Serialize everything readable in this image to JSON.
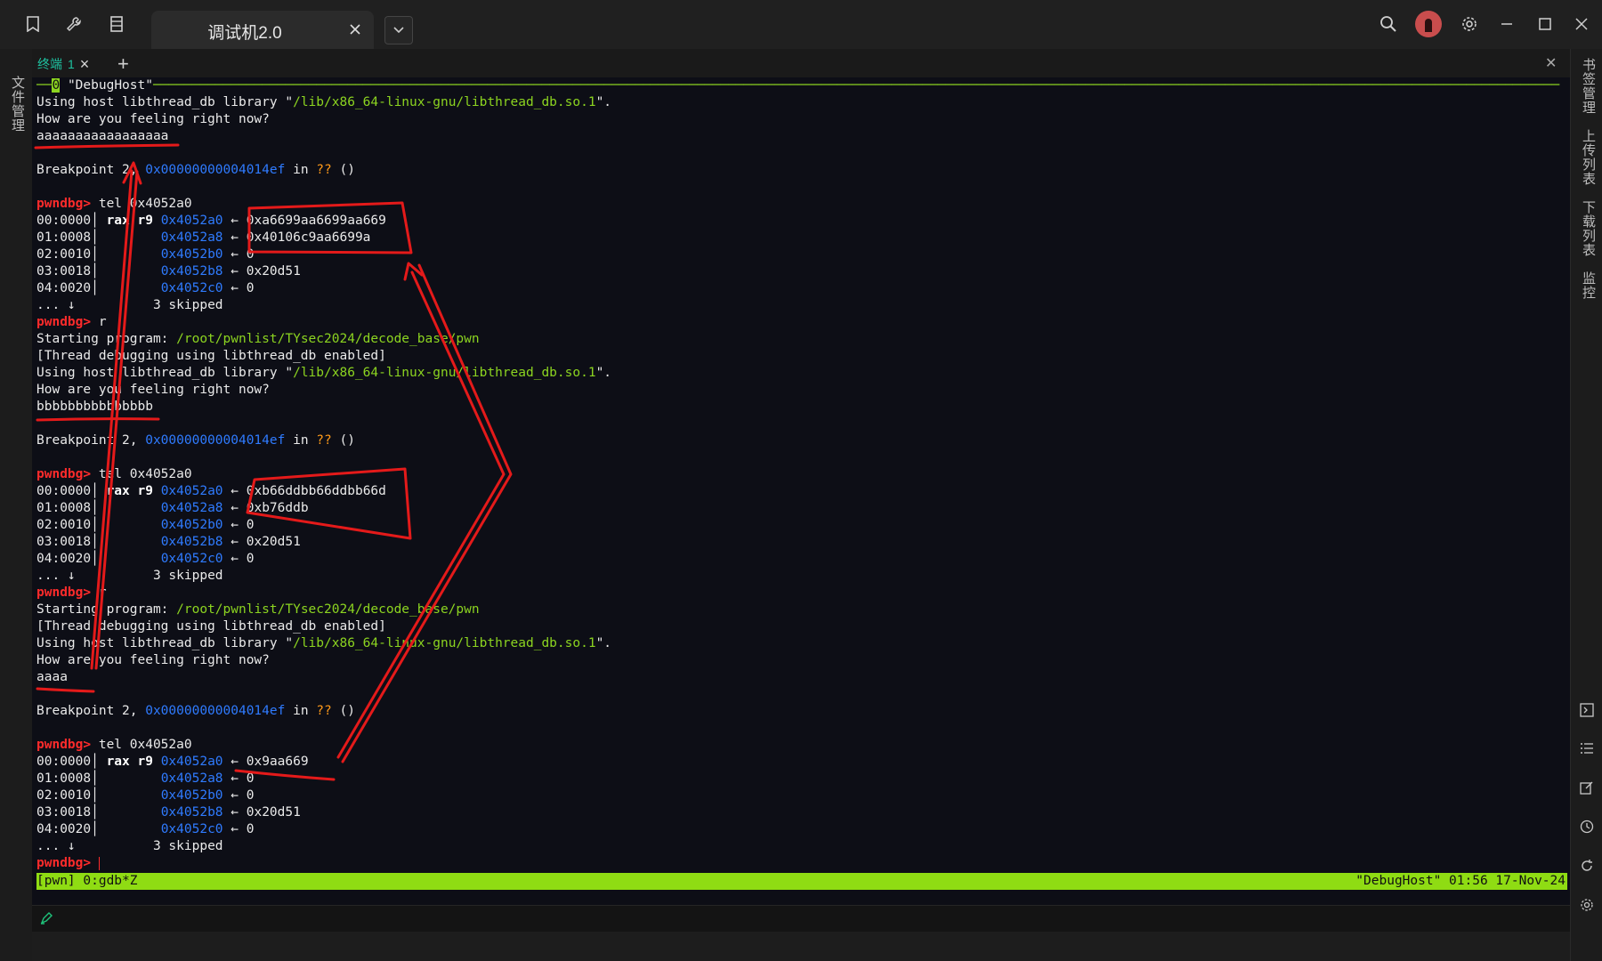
{
  "window": {
    "tab_title": "调试机2.0"
  },
  "left_sidebar": {
    "label": "文件管理"
  },
  "right_sidebar": {
    "labels": [
      "书签管理",
      "上传列表",
      "下载列表",
      "监控"
    ]
  },
  "terminal_tabs": {
    "tab_label": "终端",
    "tab_number": "1"
  },
  "terminal": {
    "session_marker": "0",
    "session_title": "\"DebugHost\"",
    "prompt": "pwndbg>",
    "l1_a": "Using host libthread_db library \"",
    "l1_b": "/lib/x86_64-linux-gnu/libthread_db.so.1",
    "l1_c": "\".",
    "l2": "How are you feeling right now?",
    "l3": "aaaaaaaaaaaaaaaaa",
    "bp_a": "Breakpoint 2, ",
    "bp_addr": "0x00000000004014ef",
    "bp_in": " in ",
    "bp_q": "??",
    "bp_end": " ()",
    "cmd_tel": " tel 0x4052a0",
    "cmd_r": " r",
    "start_a": "Starting program: ",
    "start_path": "/root/pwnlist/TYsec2024/decode_base/pwn",
    "thread_dbg": "[Thread debugging using libthread_db enabled]",
    "input2": "bbbbbbbbbbbbbbb",
    "input3": "aaaa",
    "off0": "00:0000│ ",
    "off1": "01:0008│ ",
    "off2": "02:0010│ ",
    "off3": "03:0018│ ",
    "off4": "04:0020│ ",
    "regs": "rax r9",
    "a0": "0x4052a0",
    "a1": "0x4052a8",
    "a2": "0x4052b0",
    "a3": "0x4052b8",
    "a4": "0x4052c0",
    "arrow": " ← ",
    "skip_a": "... ↓",
    "skip_b": "3 skipped",
    "v_zero": "0",
    "v_20d51": "0x20d51",
    "t1_v0": "0xa6699aa6699aa669",
    "t1_v1": "0x40106c9aa6699a",
    "t2_v0": "0xb66ddbb66ddbb66d",
    "t2_v1": "0xb76ddb",
    "t3_v0": "0x9aa669"
  },
  "status_bar": {
    "left": "[pwn] 0:gdb*Z",
    "right": "\"DebugHost\" 01:56 17-Nov-24"
  }
}
